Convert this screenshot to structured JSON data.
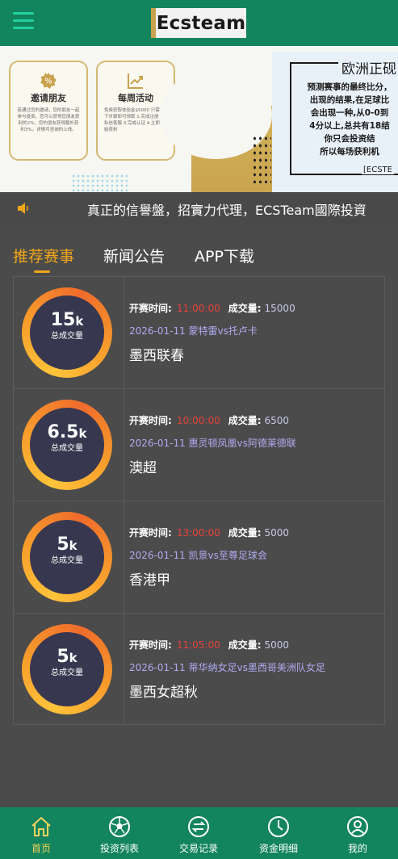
{
  "header": {
    "logo_text": "Ecsteam"
  },
  "banner": {
    "card1": {
      "title": "邀请朋友",
      "icon": "percent-badge-icon",
      "desc": "若通过您的邀请，您的朋友一起参与投资，您可以获得您朋友获利的2%，您的朋友获得额外获利3%，详情可咨询的上线。"
    },
    "card2": {
      "title": "每周活动",
      "icon": "chart-up-icon",
      "desc": "免费获取体验金$5000 只需以下步骤即可领取 1.完成注册 2.私信客服 3.完成认证 4.立即开始获利"
    },
    "panel": {
      "title": "欧洲正砚",
      "lines": [
        "预测赛事的最终比分，",
        "出现的结果,在足球比",
        "会出现一种,从0-0到",
        "4分以上,总共有18结",
        "你只会投资结",
        "所以每场获利机"
      ],
      "footer": "[ECSTE"
    }
  },
  "notice": {
    "icon": "speaker-icon",
    "text": "真正的信譽盤，招實力代理，ECSTeam國際投資"
  },
  "tabs": [
    {
      "label": "推荐赛事",
      "active": true
    },
    {
      "label": "新闻公告",
      "active": false
    },
    {
      "label": "APP下载",
      "active": false
    }
  ],
  "matches": [
    {
      "volume_big": "15",
      "volume_unit": "k",
      "volume_label": "总成交量",
      "start_label": "开赛时间:",
      "start_time": "11:00:00",
      "volume_text_label": "成交量:",
      "volume_text": "15000",
      "date_teams": "2026-01-11 蒙特雷vs托卢卡",
      "league": "墨西联春"
    },
    {
      "volume_big": "6.5",
      "volume_unit": "k",
      "volume_label": "总成交量",
      "start_label": "开赛时间:",
      "start_time": "10:00:00",
      "volume_text_label": "成交量:",
      "volume_text": "6500",
      "date_teams": "2026-01-11 惠灵顿凤凰vs阿德莱德联",
      "league": "澳超"
    },
    {
      "volume_big": "5",
      "volume_unit": "k",
      "volume_label": "总成交量",
      "start_label": "开赛时间:",
      "start_time": "13:00:00",
      "volume_text_label": "成交量:",
      "volume_text": "5000",
      "date_teams": "2026-01-11 凯景vs至尊足球会",
      "league": "香港甲"
    },
    {
      "volume_big": "5",
      "volume_unit": "k",
      "volume_label": "总成交量",
      "start_label": "开赛时间:",
      "start_time": "11:05:00",
      "volume_text_label": "成交量:",
      "volume_text": "5000",
      "date_teams": "2026-01-11 蒂华纳女足vs墨西哥美洲队女足",
      "league": "墨西女超秋"
    }
  ],
  "bottom_nav": [
    {
      "label": "首页",
      "icon": "home-icon",
      "active": true
    },
    {
      "label": "投资列表",
      "icon": "soccer-ball-icon",
      "active": false
    },
    {
      "label": "交易记录",
      "icon": "exchange-icon",
      "active": false
    },
    {
      "label": "资金明细",
      "icon": "clock-icon",
      "active": false
    },
    {
      "label": "我的",
      "icon": "user-icon",
      "active": false
    }
  ],
  "colors": {
    "brand_green": "#13855e",
    "accent_orange": "#f0a51b",
    "time_red": "#e8413b",
    "team_purple": "#b0a9f0",
    "gold": "#c9a24d"
  }
}
